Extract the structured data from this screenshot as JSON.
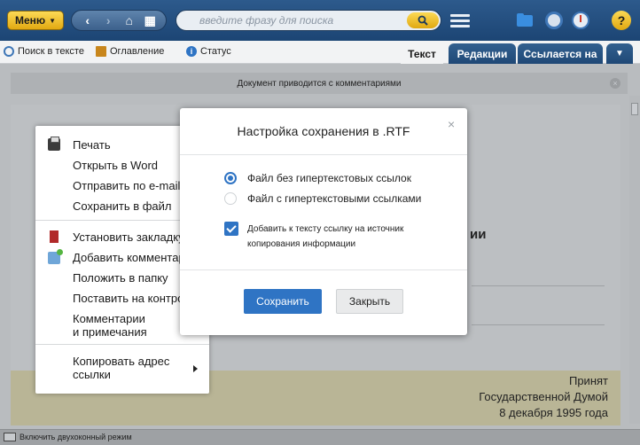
{
  "topbar": {
    "menu_label": "Меню",
    "search_placeholder": "введите фразу для поиска"
  },
  "toolbar": {
    "search_in_text": "Поиск в тексте",
    "contents": "Оглавление",
    "status": "Статус",
    "tabs": [
      {
        "label": "Текст",
        "active": true
      },
      {
        "label": "Редакции",
        "active": false
      },
      {
        "label": "Ссылается на",
        "active": false
      }
    ]
  },
  "document": {
    "notice": "Документ приводится с комментариями",
    "heading_fragment": "ии",
    "signature": [
      "Принят",
      "Государственной Думой",
      "8 декабря 1995 года"
    ]
  },
  "context_menu": {
    "items": [
      {
        "label": "Печать",
        "icon": "printer-icon"
      },
      {
        "label": "Открыть в Word"
      },
      {
        "label": "Отправить по e-mail"
      },
      {
        "label": "Сохранить в файл"
      },
      {
        "label": "Установить закладку",
        "icon": "bookmark-icon"
      },
      {
        "label": "Добавить комментарий",
        "icon": "comment-icon"
      },
      {
        "label": "Положить в папку"
      },
      {
        "label": "Поставить на контроль"
      },
      {
        "label": "Комментарии и примечания"
      },
      {
        "label": "Копировать адрес ссылки"
      }
    ],
    "comments_line1": "Комментарии",
    "comments_line2": "и примечания",
    "copy_line1": "Копировать адрес",
    "copy_line2": "ссылки"
  },
  "dialog": {
    "title": "Настройка сохранения в .RTF",
    "options": [
      {
        "label": "Файл без гипертекстовых ссылок",
        "selected": true
      },
      {
        "label": "Файл с гипертекстовыми ссылками",
        "selected": false
      }
    ],
    "checkbox_line1": "Добавить к тексту ссылку на источник",
    "checkbox_line2": "копирования информации",
    "checkbox_checked": true,
    "save_label": "Сохранить",
    "close_label": "Закрыть"
  },
  "statusbar": {
    "two_window_label": "Включить двухоконный режим"
  },
  "colors": {
    "topbar": "#1f4876",
    "accent": "#2f74c4",
    "yellow_button": "#f0c23a"
  }
}
